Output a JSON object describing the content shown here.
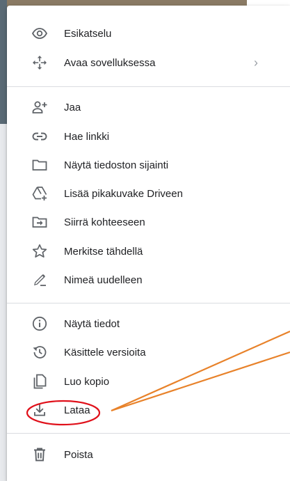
{
  "menu": {
    "items": [
      {
        "label": "Esikatselu",
        "icon": "eye-icon"
      },
      {
        "label": "Avaa sovelluksessa",
        "icon": "move-arrows-icon",
        "submenu_indicator": "›"
      },
      {
        "label": "Jaa",
        "icon": "person-add-icon"
      },
      {
        "label": "Hae linkki",
        "icon": "link-icon"
      },
      {
        "label": "Näytä tiedoston sijainti",
        "icon": "folder-icon"
      },
      {
        "label": "Lisää pikakuvake Driveen",
        "icon": "drive-shortcut-icon"
      },
      {
        "label": "Siirrä kohteeseen",
        "icon": "move-to-folder-icon"
      },
      {
        "label": "Merkitse tähdellä",
        "icon": "star-icon"
      },
      {
        "label": "Nimeä uudelleen",
        "icon": "pencil-icon"
      },
      {
        "label": "Näytä tiedot",
        "icon": "info-icon"
      },
      {
        "label": "Käsittele versioita",
        "icon": "history-icon"
      },
      {
        "label": "Luo kopio",
        "icon": "copy-icon"
      },
      {
        "label": "Lataa",
        "icon": "download-icon"
      },
      {
        "label": "Poista",
        "icon": "trash-icon"
      }
    ]
  },
  "colors": {
    "text": "#202124",
    "icon": "#5f6368",
    "divider": "#dadce0",
    "annotation_circle": "#e0101a",
    "annotation_lines": "#e8822a"
  }
}
